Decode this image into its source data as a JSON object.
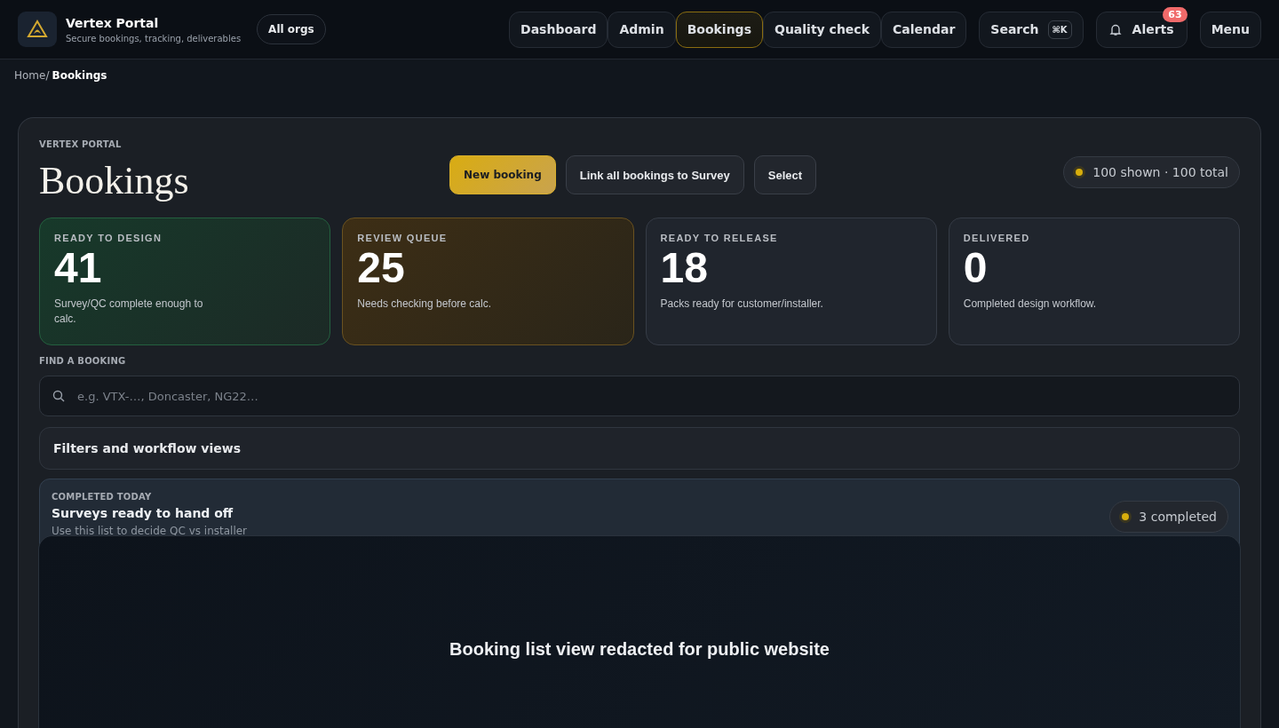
{
  "brand": {
    "name": "Vertex Portal",
    "tagline": "Secure bookings, tracking, deliverables"
  },
  "org_switch": "All orgs",
  "nav": [
    {
      "label": "Dashboard",
      "selected": false
    },
    {
      "label": "Admin",
      "selected": false
    },
    {
      "label": "Bookings",
      "selected": true
    },
    {
      "label": "Quality check",
      "selected": false
    },
    {
      "label": "Calendar",
      "selected": false
    }
  ],
  "search": {
    "label": "Search",
    "shortcut": "⌘K"
  },
  "alerts": {
    "label": "Alerts",
    "count": "63"
  },
  "menu": "Menu",
  "breadcrumb": {
    "parent": "Home/",
    "current": "Bookings"
  },
  "page": {
    "eyebrow": "VERTEX PORTAL",
    "title": "Bookings",
    "count_label": "100 shown · 100 total",
    "actions": [
      {
        "label": "New booking",
        "kind": "primary"
      },
      {
        "label": "Link all bookings to Survey",
        "kind": "secondary"
      },
      {
        "label": "Select",
        "kind": "secondary"
      }
    ]
  },
  "stats": [
    {
      "label": "READY TO DESIGN",
      "value": "41",
      "note": "Survey/QC complete enough to calc.",
      "kind": "success"
    },
    {
      "label": "REVIEW QUEUE",
      "value": "25",
      "note": "Needs checking before calc.",
      "kind": "warning"
    },
    {
      "label": "READY TO RELEASE",
      "value": "18",
      "note": "Packs ready for customer/installer.",
      "kind": "neutral"
    },
    {
      "label": "DELIVERED",
      "value": "0",
      "note": "Completed design workflow.",
      "kind": "neutral"
    }
  ],
  "find": {
    "label": "FIND A BOOKING",
    "placeholder": "e.g. VTX-…, Doncaster, NG22…"
  },
  "filters": {
    "label": "Filters and workflow views",
    "expanded": false
  },
  "completed": {
    "eyebrow": "COMPLETED TODAY",
    "title": "Surveys ready to hand off",
    "note": "Use this list to decide QC vs installer",
    "count": "3 completed"
  },
  "redacted": "Booking list view redacted for public website"
}
